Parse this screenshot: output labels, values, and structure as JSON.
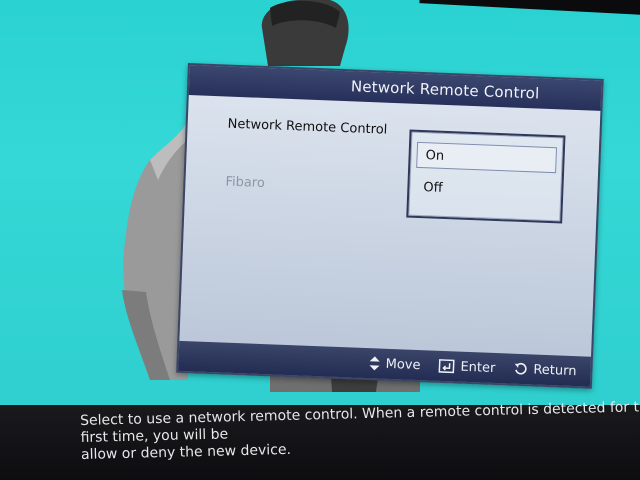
{
  "dialog": {
    "title": "Network Remote Control",
    "menu": {
      "active_label": "Network Remote Control",
      "disabled_label": "Fibaro"
    },
    "options": [
      {
        "label": "On",
        "selected": true
      },
      {
        "label": "Off",
        "selected": false
      }
    ],
    "footer": {
      "move_label": "Move",
      "enter_label": "Enter",
      "return_label": "Return"
    }
  },
  "info_bar": {
    "text": "Select to use a network remote control. When a remote control is detected for the first time, you will be\nallow or deny the new device."
  },
  "colors": {
    "background": "#2ad2d2",
    "dialog_header": "#26305a",
    "dialog_body": "#c9d3e2",
    "info_bar": "#111113"
  },
  "icons": [
    "move-arrows-icon",
    "enter-icon",
    "return-icon"
  ]
}
